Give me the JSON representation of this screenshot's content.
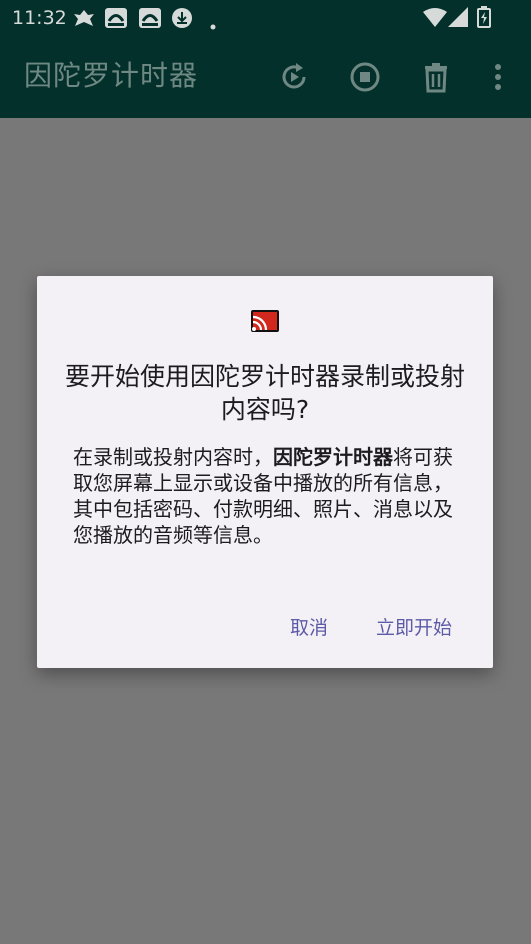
{
  "status_bar": {
    "time": "11:32",
    "icons": [
      "notification-app-icon",
      "photo-app-icon",
      "photo-app-icon",
      "download-icon",
      "dot-icon",
      "wifi-icon",
      "signal-icon",
      "battery-icon"
    ]
  },
  "app_bar": {
    "title": "因陀罗计时器",
    "actions": [
      "replay-icon",
      "stop-record-icon",
      "delete-icon",
      "more-vert-icon"
    ]
  },
  "dialog": {
    "icon": "cast-icon",
    "title": "要开始使用因陀罗计时器录制或投射内容吗?",
    "message_prefix": "在录制或投射内容时，",
    "message_app_name": "因陀罗计时器",
    "message_suffix": "将可获取您屏幕上显示或设备中播放的所有信息，其中包括密码、付款明细、照片、消息以及您播放的音频等信息。",
    "cancel_label": "取消",
    "confirm_label": "立即开始"
  },
  "colors": {
    "app_bar_bg": "#03302a",
    "scrim": "#787878",
    "dialog_bg": "#f3f1f5",
    "button_text": "#5d5aa8",
    "cast_icon": "#d2281e"
  }
}
